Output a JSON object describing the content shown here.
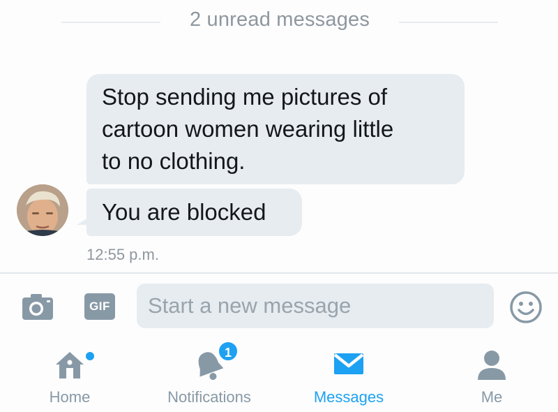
{
  "conversation": {
    "unread_label": "2 unread messages",
    "messages": [
      {
        "lines": [
          "Stop sending me pictures of",
          "cartoon women wearing little",
          "to no clothing."
        ]
      },
      {
        "lines": [
          "You are blocked"
        ]
      }
    ],
    "timestamp": "12:55 p.m."
  },
  "composer": {
    "camera_icon": "camera-icon",
    "gif_label": "GIF",
    "placeholder": "Start a new message",
    "emoji_icon": "emoji-icon"
  },
  "tabbar": {
    "items": [
      {
        "label": "Home",
        "icon": "home-icon"
      },
      {
        "label": "Notifications",
        "icon": "bell-icon",
        "badge": "1"
      },
      {
        "label": "Messages",
        "icon": "envelope-icon"
      },
      {
        "label": "Me",
        "icon": "person-icon"
      }
    ]
  },
  "colors": {
    "accent": "#1da1f2",
    "bubble": "#e6ecf0",
    "muted": "#8899a6"
  }
}
